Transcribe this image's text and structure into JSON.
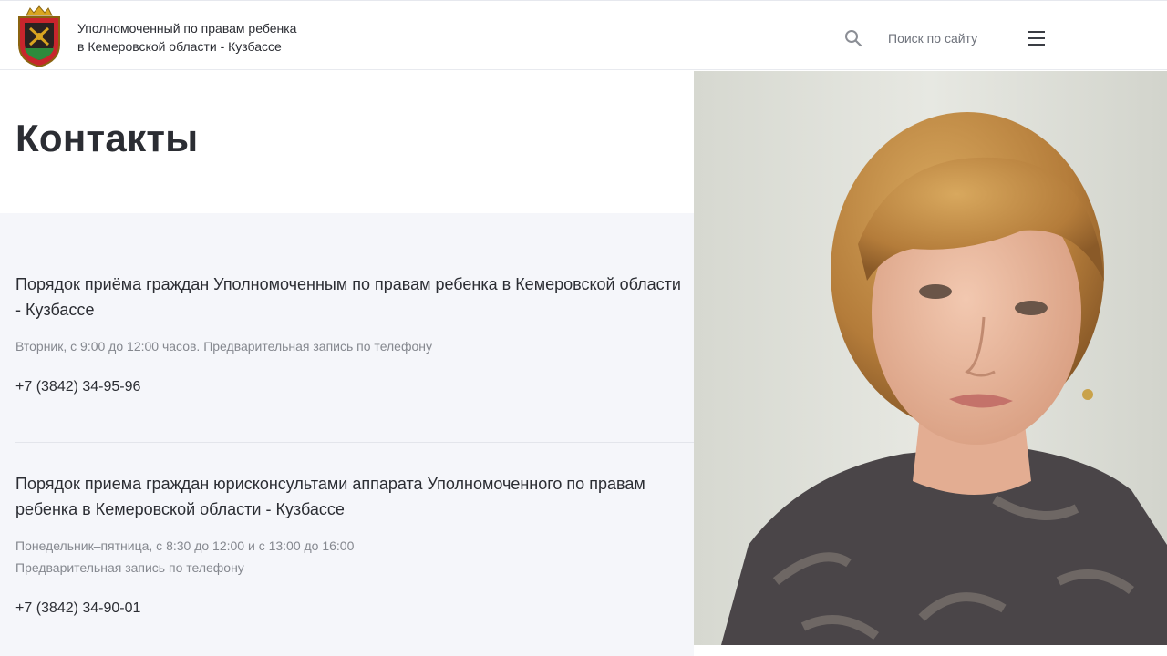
{
  "header": {
    "org_name_line1": "Уполномоченный по правам ребенка",
    "org_name_line2": "в Кемеровской области - Кузбассе",
    "search_placeholder": "Поиск по сайту",
    "icons": [
      "coat-of-arms-logo",
      "search-icon",
      "menu-icon"
    ]
  },
  "page": {
    "title": "Контакты"
  },
  "contacts": [
    {
      "title": "Порядок приёма граждан Уполномоченным по правам ребенка в Кемеровской области - Кузбассе",
      "hours": [
        "Вторник, с 9:00 до 12:00 часов. Предварительная запись по телефону"
      ],
      "phone": "+7 (3842) 34-95-96"
    },
    {
      "title": "Порядок приема граждан юрисконсультами аппарата Уполномоченного по правам ребенка в Кемеровской области - Кузбассе",
      "hours": [
        "Понедельник–пятница, с 8:30 до 12:00 и с 13:00 до 16:00",
        "Предварительная запись по телефону"
      ],
      "phone": "+7 (3842) 34-90-01"
    }
  ],
  "colors": {
    "text": "#2b2d33",
    "muted_text": "#85888f",
    "panel_background": "#f5f6fa",
    "logo_red": "#c8252c",
    "logo_gold": "#d9a520",
    "logo_green": "#2e8b3c"
  }
}
